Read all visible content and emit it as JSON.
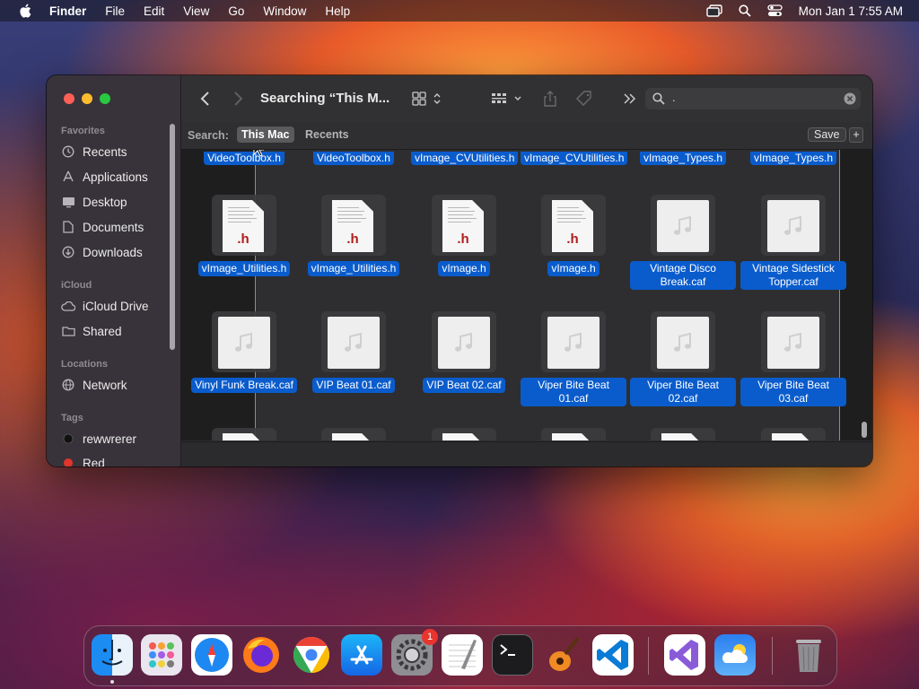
{
  "menubar": {
    "app_name": "Finder",
    "menus": [
      "File",
      "Edit",
      "View",
      "Go",
      "Window",
      "Help"
    ],
    "clock": "Mon Jan 1  7:55 AM"
  },
  "window": {
    "title": "Searching “This M...",
    "search_query": ".",
    "search_scope_label": "Search:",
    "scopes": [
      "This Mac",
      "Recents"
    ],
    "selected_scope": "This Mac",
    "save_label": "Save",
    "add_label": "+"
  },
  "sidebar": {
    "favorites_header": "Favorites",
    "favorites": [
      {
        "label": "Recents",
        "icon": "clock-icon"
      },
      {
        "label": "Applications",
        "icon": "applications-icon"
      },
      {
        "label": "Desktop",
        "icon": "desktop-icon"
      },
      {
        "label": "Documents",
        "icon": "document-icon"
      },
      {
        "label": "Downloads",
        "icon": "download-icon"
      }
    ],
    "icloud_header": "iCloud",
    "icloud": [
      {
        "label": "iCloud Drive",
        "icon": "cloud-icon"
      },
      {
        "label": "Shared",
        "icon": "shared-folder-icon"
      }
    ],
    "locations_header": "Locations",
    "locations": [
      {
        "label": "Network",
        "icon": "network-icon"
      }
    ],
    "tags_header": "Tags",
    "tags": [
      {
        "label": "rewwrerer",
        "color": "#111111"
      },
      {
        "label": "Red",
        "color": "#e0352b"
      }
    ]
  },
  "files": {
    "top_partial": [
      "VideoToolbox.h",
      "VideoToolbox.h",
      "vImage_CVUtilities.h",
      "vImage_CVUtilities.h",
      "vImage_Types.h",
      "vImage_Types.h"
    ],
    "row1": [
      {
        "name": "vImage_Utilities.h",
        "kind": "header"
      },
      {
        "name": "vImage_Utilities.h",
        "kind": "header"
      },
      {
        "name": "vImage.h",
        "kind": "header"
      },
      {
        "name": "vImage.h",
        "kind": "header"
      },
      {
        "name": "Vintage Disco Break.caf",
        "kind": "audio"
      },
      {
        "name": "Vintage Sidestick Topper.caf",
        "kind": "audio"
      }
    ],
    "row2": [
      {
        "name": "Vinyl Funk Break.caf",
        "kind": "audio"
      },
      {
        "name": "VIP Beat 01.caf",
        "kind": "audio"
      },
      {
        "name": "VIP Beat 02.caf",
        "kind": "audio"
      },
      {
        "name": "Viper Bite Beat 01.caf",
        "kind": "audio"
      },
      {
        "name": "Viper Bite Beat 02.caf",
        "kind": "audio"
      },
      {
        "name": "Viper Bite Beat 03.caf",
        "kind": "audio"
      }
    ],
    "header_ext": ".h",
    "selection_color": "#0a5ccc"
  },
  "dock": {
    "apps": [
      "Finder",
      "Launchpad",
      "Safari",
      "Firefox",
      "Chrome",
      "App Store",
      "System Settings",
      "TextEdit",
      "Terminal",
      "GarageBand",
      "Visual Studio Code",
      "Visual Studio",
      "Weather",
      "Trash"
    ],
    "settings_badge": "1"
  }
}
